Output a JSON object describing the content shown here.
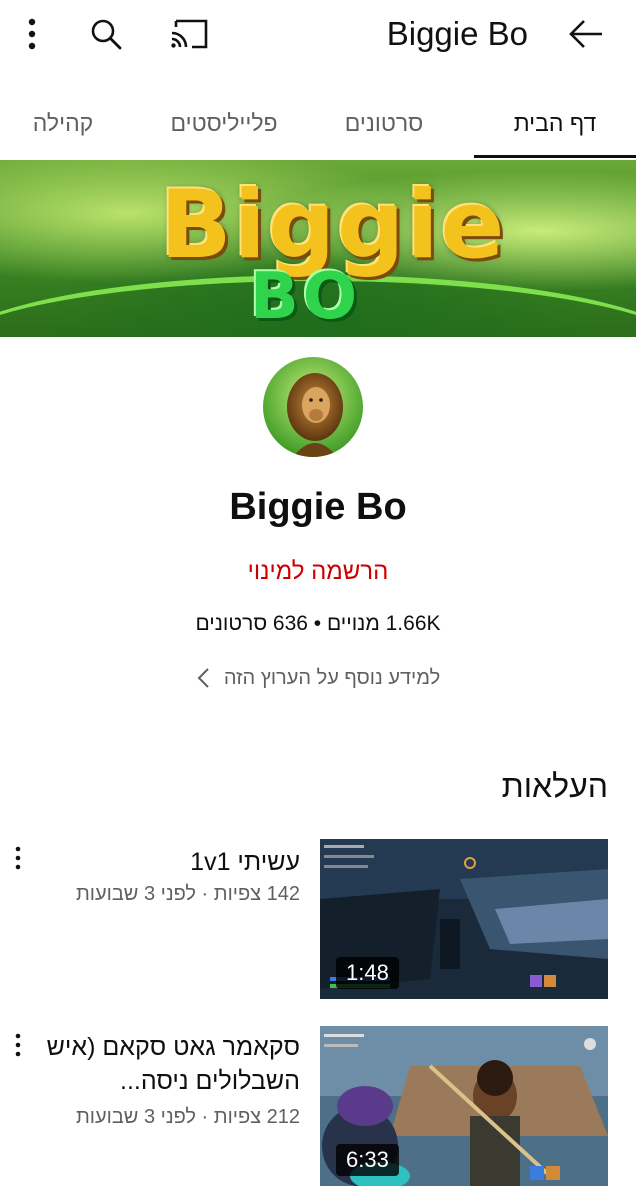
{
  "header": {
    "title": "Biggie Bo"
  },
  "tabs": [
    {
      "label": "דף הבית",
      "active": true
    },
    {
      "label": "סרטונים",
      "active": false
    },
    {
      "label": "פלייליסטים",
      "active": false
    },
    {
      "label": "קהילה",
      "active": false
    }
  ],
  "banner": {
    "wordmark": "Biggie",
    "subword": "BO"
  },
  "channel": {
    "name": "Biggie Bo",
    "subscribe_label": "הרשמה למינוי",
    "stats": "1.66K מנויים • 636 סרטונים",
    "more_info": "למידע נוסף על הערוץ הזה"
  },
  "section": {
    "title": "העלאות"
  },
  "videos": [
    {
      "title": "עשיתי 1v1",
      "meta": "142 צפיות · לפני 3 שבועות",
      "duration": "1:48"
    },
    {
      "title": "סקאמר גאט סקאם (איש השבלולים ניסה...",
      "meta": "212 צפיות · לפני 3 שבועות",
      "duration": "6:33"
    }
  ],
  "colors": {
    "subscribe": "#cc0000",
    "text": "#0f0f0f",
    "secondary": "#606060"
  }
}
